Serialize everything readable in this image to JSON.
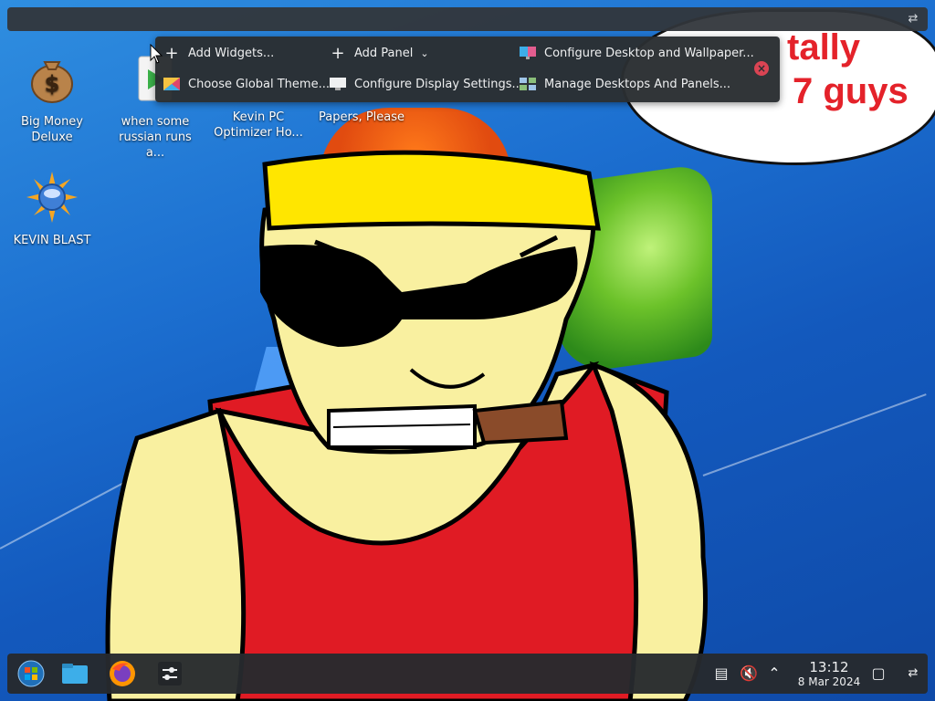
{
  "toolbar": {
    "add_widgets": "Add Widgets...",
    "add_panel": "Add Panel",
    "configure_desktop": "Configure Desktop and Wallpaper...",
    "choose_theme": "Choose Global Theme...",
    "display_settings": "Configure Display Settings...",
    "manage_desktops": "Manage Desktops And Panels..."
  },
  "desktop_icons": [
    {
      "label": "Big Money Deluxe",
      "icon": "money-bag-icon"
    },
    {
      "label": "when some russian runs a...",
      "icon": "video-file-icon"
    },
    {
      "label": "Kevin PC Optimizer Ho...",
      "icon": "app-icon"
    },
    {
      "label": "Papers, Please",
      "icon": "game-icon"
    },
    {
      "label": "KEVIN BLAST",
      "icon": "blast-sun-icon"
    }
  ],
  "bubble": {
    "line1": "tally",
    "line2": "7 guys"
  },
  "taskbar": {
    "apps": [
      "start-icon",
      "file-manager-icon",
      "firefox-icon",
      "settings-icon"
    ],
    "time": "13:12",
    "date": "8 Mar 2024"
  },
  "colors": {
    "panel": "#31363b",
    "accent": "#3daee9",
    "close": "#da4453",
    "bubble_text": "#e4222a"
  }
}
